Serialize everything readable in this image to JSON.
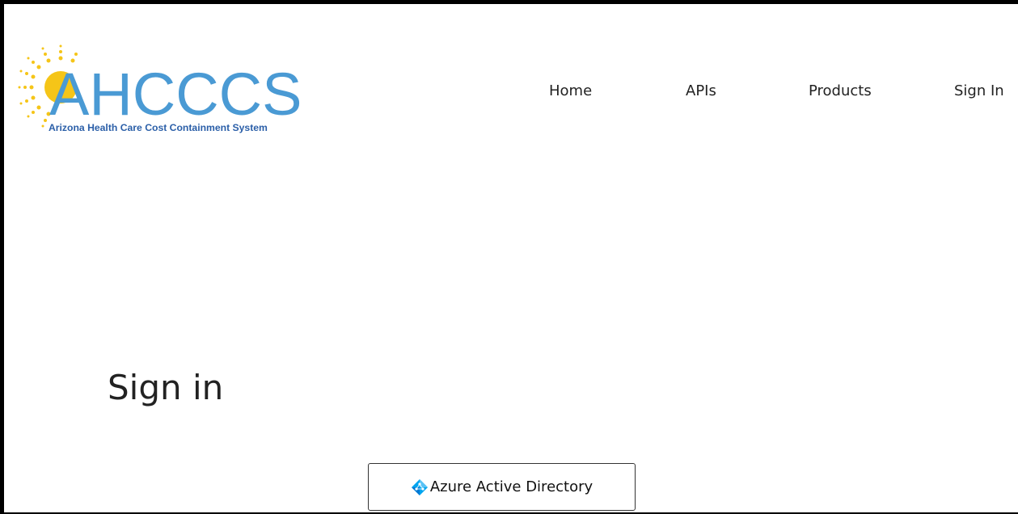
{
  "logo": {
    "wordmark": "AHCCCS",
    "tagline": "Arizona Health Care Cost Containment System",
    "colors": {
      "wordmark": "#4a9ad4",
      "tagline": "#2b5fa8",
      "sun": "#f5c518"
    }
  },
  "nav": {
    "items": [
      {
        "label": "Home"
      },
      {
        "label": "APIs"
      },
      {
        "label": "Products"
      },
      {
        "label": "Sign In"
      }
    ]
  },
  "main": {
    "title": "Sign in",
    "providers": [
      {
        "label": "Azure Active Directory",
        "icon": "azure-ad-icon",
        "color": "#00a4ef"
      }
    ]
  }
}
